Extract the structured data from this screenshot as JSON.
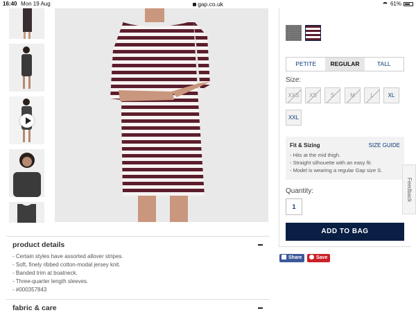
{
  "status_bar": {
    "time": "16:40",
    "date": "Mon 19 Aug",
    "url": "gap.co.uk",
    "battery": "61%"
  },
  "product_details": {
    "title": "product details",
    "items": [
      "- Certain styles have assorted allover stripes.",
      "- Soft, finely ribbed cotton-modal jersey knit.",
      "- Banded trim at boatneck.",
      "- Three-quarter length sleeves.",
      "- #000357843"
    ]
  },
  "fabric_care": {
    "title": "fabric & care"
  },
  "fit_tabs": [
    {
      "label": "PETITE"
    },
    {
      "label": "REGULAR"
    },
    {
      "label": "TALL"
    }
  ],
  "size": {
    "label": "Size:",
    "options": [
      {
        "label": "XXS",
        "available": false
      },
      {
        "label": "XS",
        "available": false
      },
      {
        "label": "S",
        "available": false
      },
      {
        "label": "M",
        "available": false
      },
      {
        "label": "L",
        "available": false
      },
      {
        "label": "XL",
        "available": true
      },
      {
        "label": "XXL",
        "available": true
      }
    ]
  },
  "fit": {
    "title": "Fit & Sizing",
    "guide_link": "SIZE GUIDE",
    "items": [
      "- Hits at the mid thigh.",
      "- Straight silhouette with an easy fit.",
      "- Model is wearing a regular Gap size S."
    ]
  },
  "quantity": {
    "label": "Quantity:",
    "value": "1"
  },
  "add_to_bag": "ADD TO BAG",
  "share": {
    "facebook": "Share",
    "pinterest": "Save"
  },
  "feedback": "Feedback",
  "colors": {
    "stripe_dark": "#5c1e2c",
    "navy": "#0a1f44",
    "link_blue": "#0a3a78",
    "facebook": "#3b5998",
    "pinterest": "#cb2027"
  }
}
